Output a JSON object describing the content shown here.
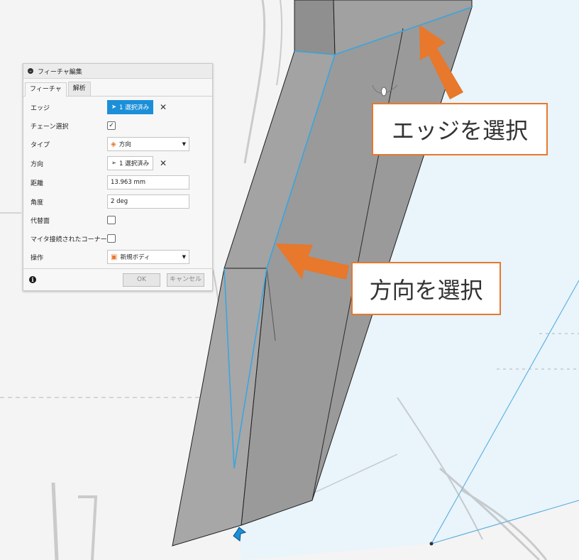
{
  "dialog": {
    "title": "フィーチャ編集",
    "tabs": [
      "フィーチャ",
      "解析"
    ],
    "rows": {
      "edge": {
        "label": "エッジ",
        "value": "1 選択済み"
      },
      "chain": {
        "label": "チェーン選択",
        "checked": true
      },
      "type": {
        "label": "タイプ",
        "value": "方向"
      },
      "direction": {
        "label": "方向",
        "value": "1 選択済み"
      },
      "distance": {
        "label": "距離",
        "value": "13.963 mm"
      },
      "angle": {
        "label": "角度",
        "value": "2 deg"
      },
      "alt_face": {
        "label": "代替面",
        "checked": false
      },
      "miter": {
        "label": "マイタ接続されたコーナー",
        "checked": false
      },
      "operation": {
        "label": "操作",
        "value": "新規ボディ"
      }
    },
    "ok_label": "OK",
    "cancel_label": "キャンセル"
  },
  "callouts": {
    "edge": "エッジを選択",
    "direction": "方向を選択"
  },
  "colors": {
    "accent_blue": "#1c8fd8",
    "callout_orange": "#e7782c",
    "selection_edge": "#3aa6e0"
  }
}
